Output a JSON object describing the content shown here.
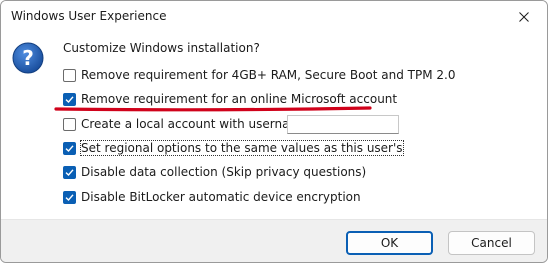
{
  "window": {
    "title": "Windows User Experience",
    "close_icon": "close-icon"
  },
  "dialog": {
    "icon": "question-icon",
    "prompt": "Customize Windows installation?",
    "options": [
      {
        "label": "Remove requirement for 4GB+ RAM, Secure Boot and TPM 2.0",
        "checked": false
      },
      {
        "label": "Remove requirement for an online Microsoft account",
        "checked": true
      },
      {
        "label": "Create a local account with username:",
        "checked": false
      },
      {
        "label": "Set regional options to the same values as this user's",
        "checked": true
      },
      {
        "label": "Disable data collection (Skip privacy questions)",
        "checked": true
      },
      {
        "label": "Disable BitLocker automatic device encryption",
        "checked": true
      }
    ],
    "username_value": "",
    "highlight_color": "#d0021b",
    "accent_color": "#0a5fb4"
  },
  "footer": {
    "ok_label": "OK",
    "cancel_label": "Cancel"
  }
}
